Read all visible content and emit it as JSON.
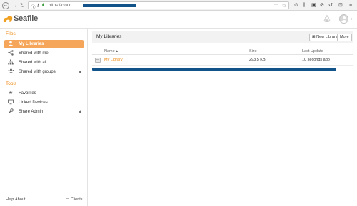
{
  "browser": {
    "back_icon": "back-arrow",
    "forward_icon": "forward-arrow",
    "reload_icon": "reload",
    "url": "https://cloud.",
    "menu_icon": "hamburger"
  },
  "app": {
    "logo_text": "Seafile",
    "brand_color": "#eb8205",
    "active_color": "#f6a65a"
  },
  "sidebar": {
    "files_title": "Files",
    "files_items": [
      {
        "label": "My Libraries",
        "icon": "user-icon",
        "active": true
      },
      {
        "label": "Shared with me",
        "icon": "share-icon"
      },
      {
        "label": "Shared with all",
        "icon": "network-icon"
      },
      {
        "label": "Shared with groups",
        "icon": "group-icon",
        "has_caret": true
      }
    ],
    "tools_title": "Tools",
    "tools_items": [
      {
        "label": "Favorites",
        "icon": "star-icon"
      },
      {
        "label": "Linked Devices",
        "icon": "monitor-icon"
      },
      {
        "label": "Share Admin",
        "icon": "wrench-icon",
        "has_caret": true
      }
    ],
    "footer": {
      "help": "Help",
      "about": "About",
      "clients": "Clients"
    }
  },
  "main": {
    "title": "My Libraries",
    "new_library_label": "New Library",
    "more_label": "More",
    "columns": {
      "name": "Name ▴",
      "size": "Size",
      "last_update": "Last Update"
    },
    "rows": [
      {
        "name": "My Library",
        "size": "293.5 KB",
        "updated": "10 seconds ago"
      }
    ]
  }
}
